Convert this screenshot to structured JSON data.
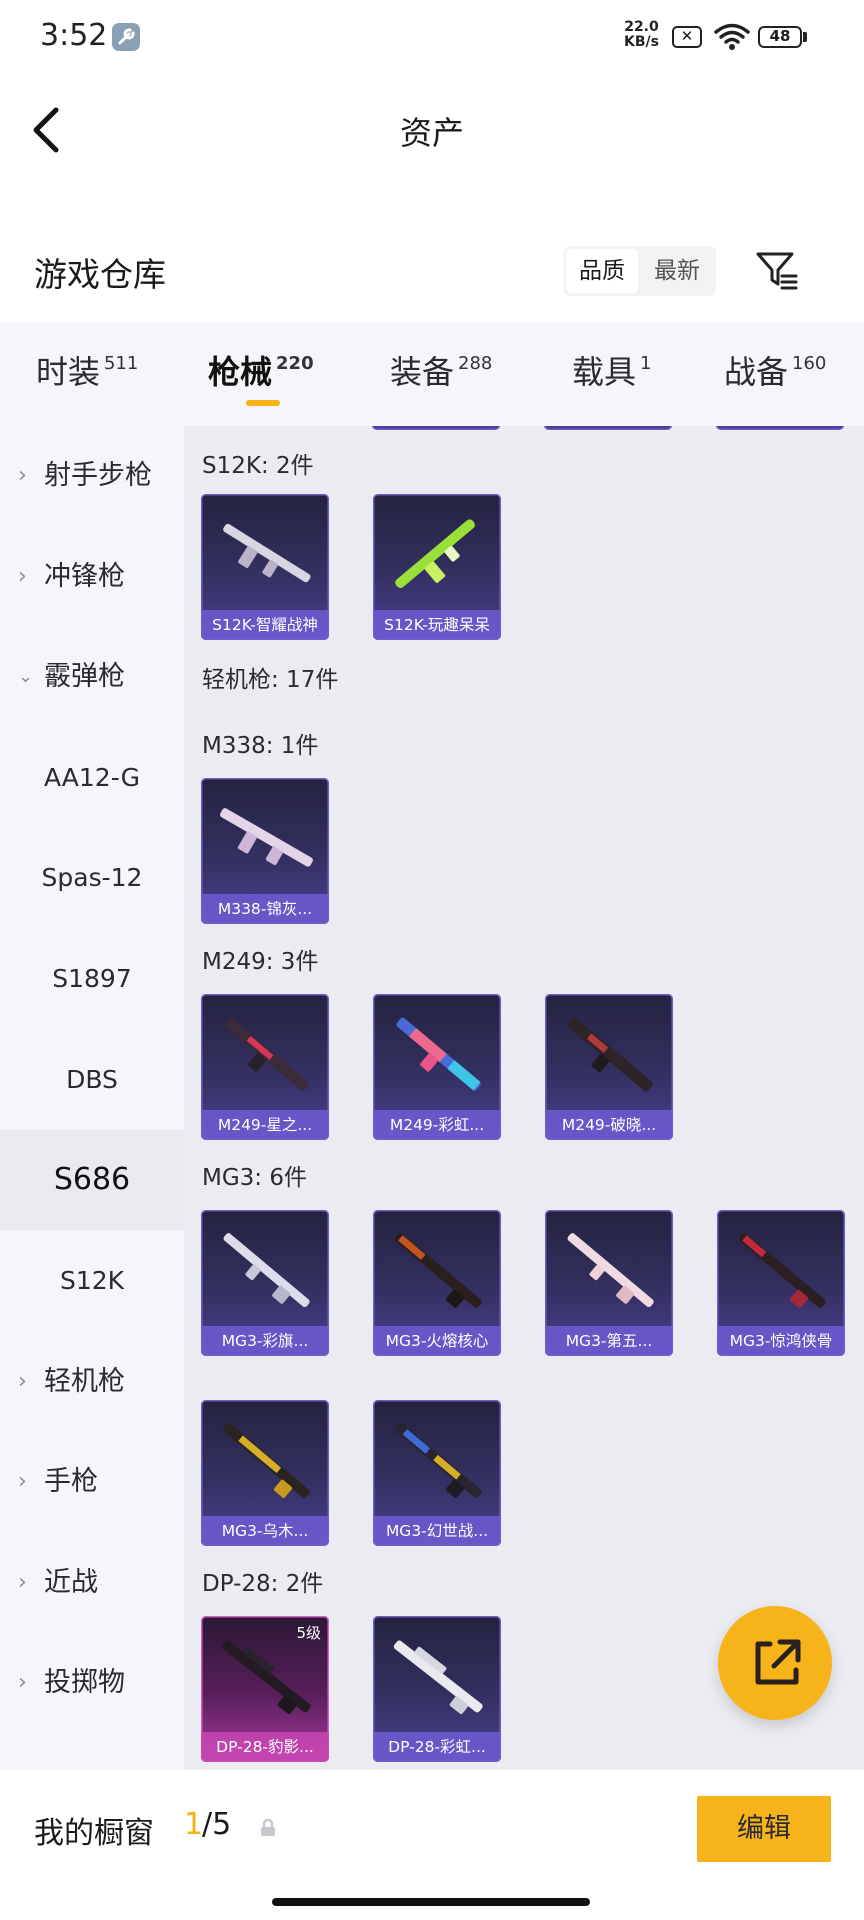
{
  "status": {
    "time": "3:52",
    "net_speed_value": "22.0",
    "net_speed_unit": "KB/s",
    "battery": "48"
  },
  "header": {
    "title": "资产"
  },
  "warehouse": {
    "title": "游戏仓库",
    "sort_quality": "品质",
    "sort_newest": "最新"
  },
  "tabs": [
    {
      "label": "时装",
      "count": "511"
    },
    {
      "label": "枪械",
      "count": "220"
    },
    {
      "label": "装备",
      "count": "288"
    },
    {
      "label": "载具",
      "count": "1"
    },
    {
      "label": "战备",
      "count": "160"
    }
  ],
  "sidebar": {
    "categories": [
      "射手步枪",
      "冲锋枪",
      "霰弹枪",
      "轻机枪",
      "手枪",
      "近战",
      "投掷物"
    ],
    "subs": [
      "AA12-G",
      "Spas-12",
      "S1897",
      "DBS",
      "S686",
      "S12K"
    ]
  },
  "content": {
    "sections": [
      {
        "title": "S12K: 2件"
      },
      {
        "title": "轻机枪: 17件"
      },
      {
        "title": "M338: 1件"
      },
      {
        "title": "M249: 3件"
      },
      {
        "title": "MG3: 6件"
      },
      {
        "title": "DP-28: 2件"
      }
    ],
    "cards": [
      {
        "name": "S12K-智耀战神"
      },
      {
        "name": "S12K-玩趣呆呆"
      },
      {
        "name": "M338-锦灰..."
      },
      {
        "name": "M249-星之..."
      },
      {
        "name": "M249-彩虹..."
      },
      {
        "name": "M249-破晓..."
      },
      {
        "name": "MG3-彩旗..."
      },
      {
        "name": "MG3-火熔核心"
      },
      {
        "name": "MG3-第五..."
      },
      {
        "name": "MG3-惊鸿侠骨"
      },
      {
        "name": "MG3-乌木..."
      },
      {
        "name": "MG3-幻世战..."
      },
      {
        "name": "DP-28-豹影...",
        "level": "5级"
      },
      {
        "name": "DP-28-彩虹..."
      }
    ]
  },
  "bottom": {
    "showcase_label": "我的橱窗",
    "showcase_current": "1",
    "showcase_total": "/5",
    "edit_label": "编辑"
  },
  "colors": {
    "accent": "#f5b213",
    "card_purple": "#4a3f92",
    "card_pink": "#a93aa1"
  },
  "icons": [
    "wrench-icon",
    "sim-off-icon",
    "wifi-icon",
    "battery-icon",
    "back-icon",
    "filter-icon",
    "share-icon",
    "lock-icon",
    "chevron-right-icon",
    "chevron-down-icon"
  ]
}
